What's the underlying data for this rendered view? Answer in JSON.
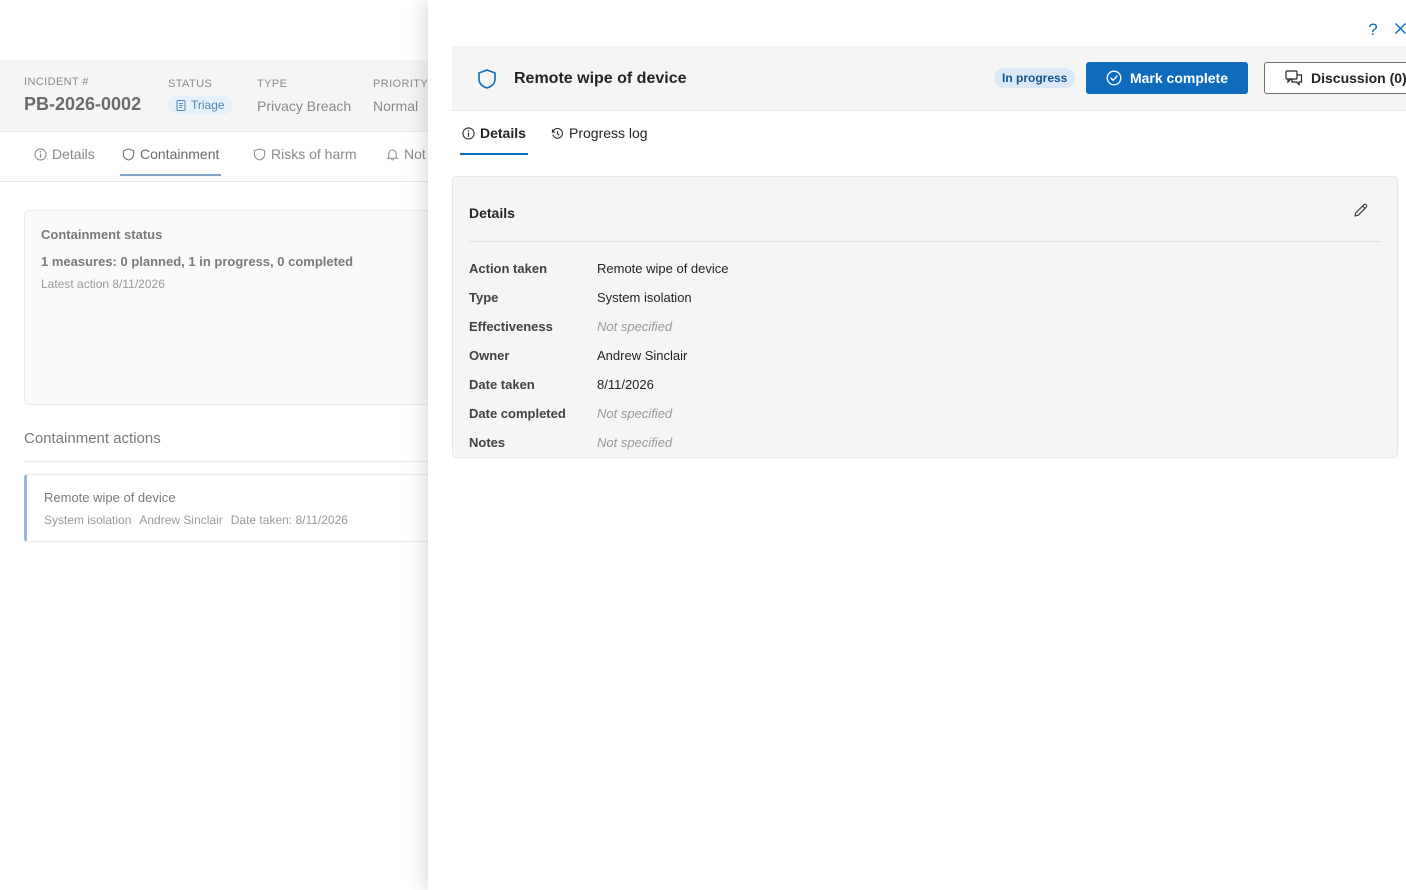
{
  "incident": {
    "number_label": "INCIDENT #",
    "number": "PB-2026-0002",
    "status_label": "STATUS",
    "status": "Triage",
    "type_label": "TYPE",
    "type": "Privacy Breach",
    "priority_label": "PRIORITY",
    "priority": "Normal"
  },
  "page_tabs": [
    "Details",
    "Containment",
    "Risks of harm",
    "Not"
  ],
  "containment_status": {
    "title": "Containment status",
    "summary": "1 measures: 0 planned, 1 in progress, 0 completed",
    "latest": "Latest action 8/11/2026"
  },
  "containment_actions": {
    "heading": "Containment actions",
    "items": [
      {
        "name": "Remote wipe of device",
        "type": "System isolation",
        "owner": "Andrew Sinclair",
        "date": "Date taken: 8/11/2026"
      }
    ]
  },
  "panel": {
    "help_label": "?",
    "title": "Remote wipe of device",
    "status_badge": "In progress",
    "mark_complete_label": "Mark complete",
    "discussion_label": "Discussion (0)",
    "tabs": [
      "Details",
      "Progress log"
    ],
    "details": {
      "title": "Details",
      "rows": [
        {
          "label": "Action taken",
          "value": "Remote wipe of device"
        },
        {
          "label": "Type",
          "value": "System isolation"
        },
        {
          "label": "Effectiveness",
          "value": "Not specified"
        },
        {
          "label": "Owner",
          "value": "Andrew Sinclair"
        },
        {
          "label": "Date taken",
          "value": "8/11/2026"
        },
        {
          "label": "Date completed",
          "value": "Not specified"
        },
        {
          "label": "Notes",
          "value": "Not specified"
        }
      ]
    }
  },
  "colors": {
    "accent": "#0f6cbd",
    "badge_bg": "#dbe9f7",
    "panel_header_bg": "#f5f5f5"
  },
  "icons": {
    "status": "document-icon",
    "details_tab": "info-icon",
    "containment_tab": "shield-icon",
    "risks_tab": "shield-icon",
    "notifications_tab": "bell-icon",
    "panel_header": "shield-icon",
    "mark_complete": "check-circle-icon",
    "discussion": "chat-icon",
    "progress_log": "history-icon",
    "edit": "pencil-icon",
    "close": "close-icon"
  }
}
